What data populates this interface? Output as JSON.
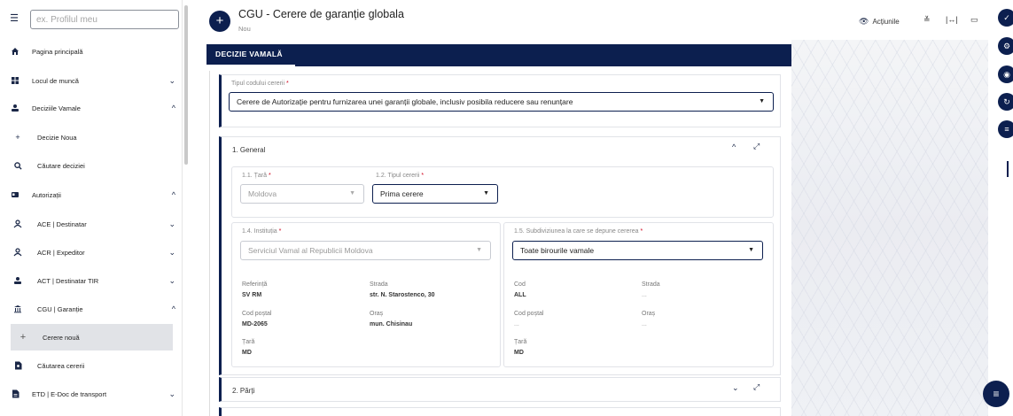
{
  "sidebar": {
    "search_placeholder": "ex. Profilul meu",
    "items": [
      {
        "label": "Pagina principală"
      },
      {
        "label": "Locul de muncă"
      },
      {
        "label": "Deciziile Vamale"
      },
      {
        "label": "Decizie Noua"
      },
      {
        "label": "Căutare deciziei"
      },
      {
        "label": "Autorizații"
      },
      {
        "label": "ACE | Destinatar"
      },
      {
        "label": "ACR | Expeditor"
      },
      {
        "label": "ACT | Destinatar TIR"
      },
      {
        "label": "CGU | Garanție"
      },
      {
        "label": "Cerere nouă"
      },
      {
        "label": "Căutarea cererii"
      },
      {
        "label": "ETD | E-Doc de transport"
      }
    ]
  },
  "header": {
    "title": "CGU - Cerere de garanție globala",
    "subtitle": "Nou",
    "actions_label": "Acțiunile"
  },
  "tabs": [
    {
      "label": "DECIZIE VAMALĂ"
    }
  ],
  "form": {
    "request_type": {
      "label": "Tipul codului cererii",
      "value": "Cerere de Autorizație pentru furnizarea unei garanții globale, inclusiv posibila reducere sau renunțare"
    },
    "general": {
      "title": "1. General",
      "country": {
        "label": "1.1. Țară",
        "value": "Moldova"
      },
      "request_kind": {
        "label": "1.2. Tipul cererii",
        "value": "Prima cerere"
      },
      "institution": {
        "label": "1.4. Instituția",
        "value": "Serviciul Vamal al Republicii Moldova",
        "ref_label": "Referință",
        "ref_value": "SV RM",
        "street_label": "Strada",
        "street_value": "str. N. Starostenco, 30",
        "postal_label": "Cod poștal",
        "postal_value": "MD-2065",
        "city_label": "Oraș",
        "city_value": "mun. Chisinau",
        "country_label": "Țară",
        "country_value": "MD"
      },
      "subdivision": {
        "label": "1.5. Subdiviziunea la care se depune cererea",
        "value": "Toate birourile vamale",
        "code_label": "Cod",
        "code_value": "ALL",
        "street_label": "Strada",
        "street_value": "...",
        "postal_label": "Cod poștal",
        "postal_value": "...",
        "city_label": "Oraș",
        "city_value": "...",
        "country_label": "Țară",
        "country_value": "MD"
      }
    },
    "parties": {
      "title": "2. Părți"
    }
  }
}
